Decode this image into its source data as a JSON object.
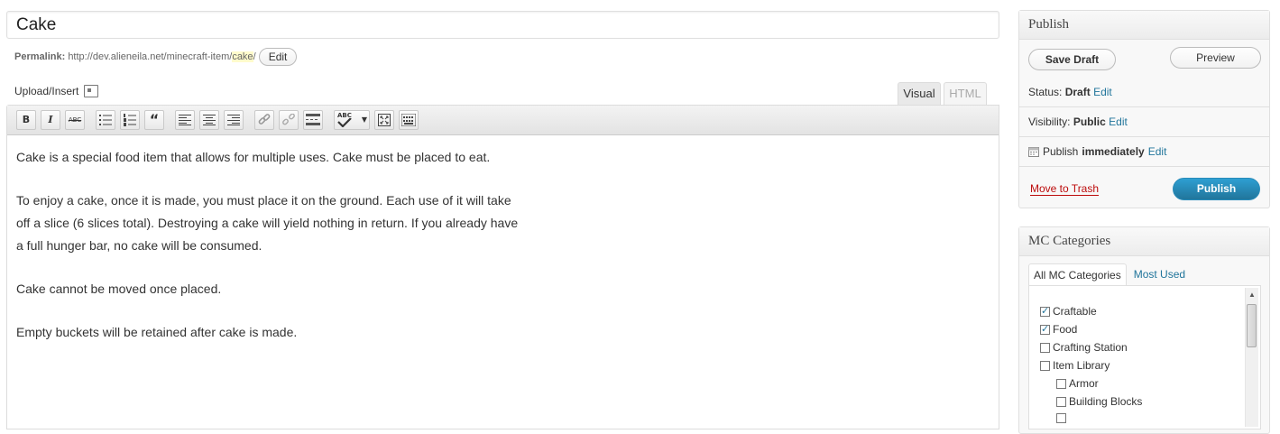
{
  "post": {
    "title": "Cake"
  },
  "permalink": {
    "label": "Permalink:",
    "base": "http://dev.alieneila.net/minecraft-item/",
    "slug": "cake",
    "trail": "/",
    "edit_label": "Edit"
  },
  "media": {
    "upload_label": "Upload/Insert"
  },
  "editor_tabs": {
    "visual": "Visual",
    "html": "HTML"
  },
  "toolbar": {
    "buttons": [
      "bold-icon",
      "italic-icon",
      "strikethrough-icon",
      "bullet-list-icon",
      "numbered-list-icon",
      "blockquote-icon",
      "align-left-icon",
      "align-center-icon",
      "align-right-icon",
      "link-icon",
      "unlink-icon",
      "more-tag-icon",
      "spellcheck-icon",
      "fullscreen-icon",
      "kitchen-sink-icon"
    ],
    "bold": "B",
    "italic": "I",
    "strike": "ABC",
    "quote": "“",
    "spell": "ABC"
  },
  "content": {
    "p1": "Cake is a special food item that allows for multiple uses. Cake must be placed to eat.",
    "p2_l1": "To enjoy a cake, once it is made, you must place it on the ground. Each use of it will take",
    "p2_l2": "off a slice (6 slices total). Destroying a cake will yield nothing in return. If you already have",
    "p2_l3": "a full hunger bar, no cake will be consumed.",
    "p3": "Cake cannot be moved once placed.",
    "p4": "Empty buckets will be retained after cake is made."
  },
  "publish": {
    "heading": "Publish",
    "save_draft": "Save Draft",
    "preview": "Preview",
    "status_label": "Status:",
    "status_value": "Draft",
    "visibility_label": "Visibility:",
    "visibility_value": "Public",
    "publish_label": "Publish",
    "publish_value": "immediately",
    "edit": "Edit",
    "trash": "Move to Trash",
    "publish_button": "Publish"
  },
  "categories": {
    "heading": "MC Categories",
    "tab_all": "All MC Categories",
    "tab_used": "Most Used",
    "items": [
      {
        "label": "Craftable",
        "checked": true
      },
      {
        "label": "Food",
        "checked": true
      },
      {
        "label": "Crafting Station",
        "checked": false
      },
      {
        "label": "Item Library",
        "checked": false
      },
      {
        "label": "Armor",
        "checked": false
      },
      {
        "label": "Building Blocks",
        "checked": false
      }
    ]
  },
  "colors": {
    "link": "#21759b",
    "publish_button": "#21759b",
    "trash": "#bc0b0b",
    "slug_highlight": "#fffbcc"
  }
}
